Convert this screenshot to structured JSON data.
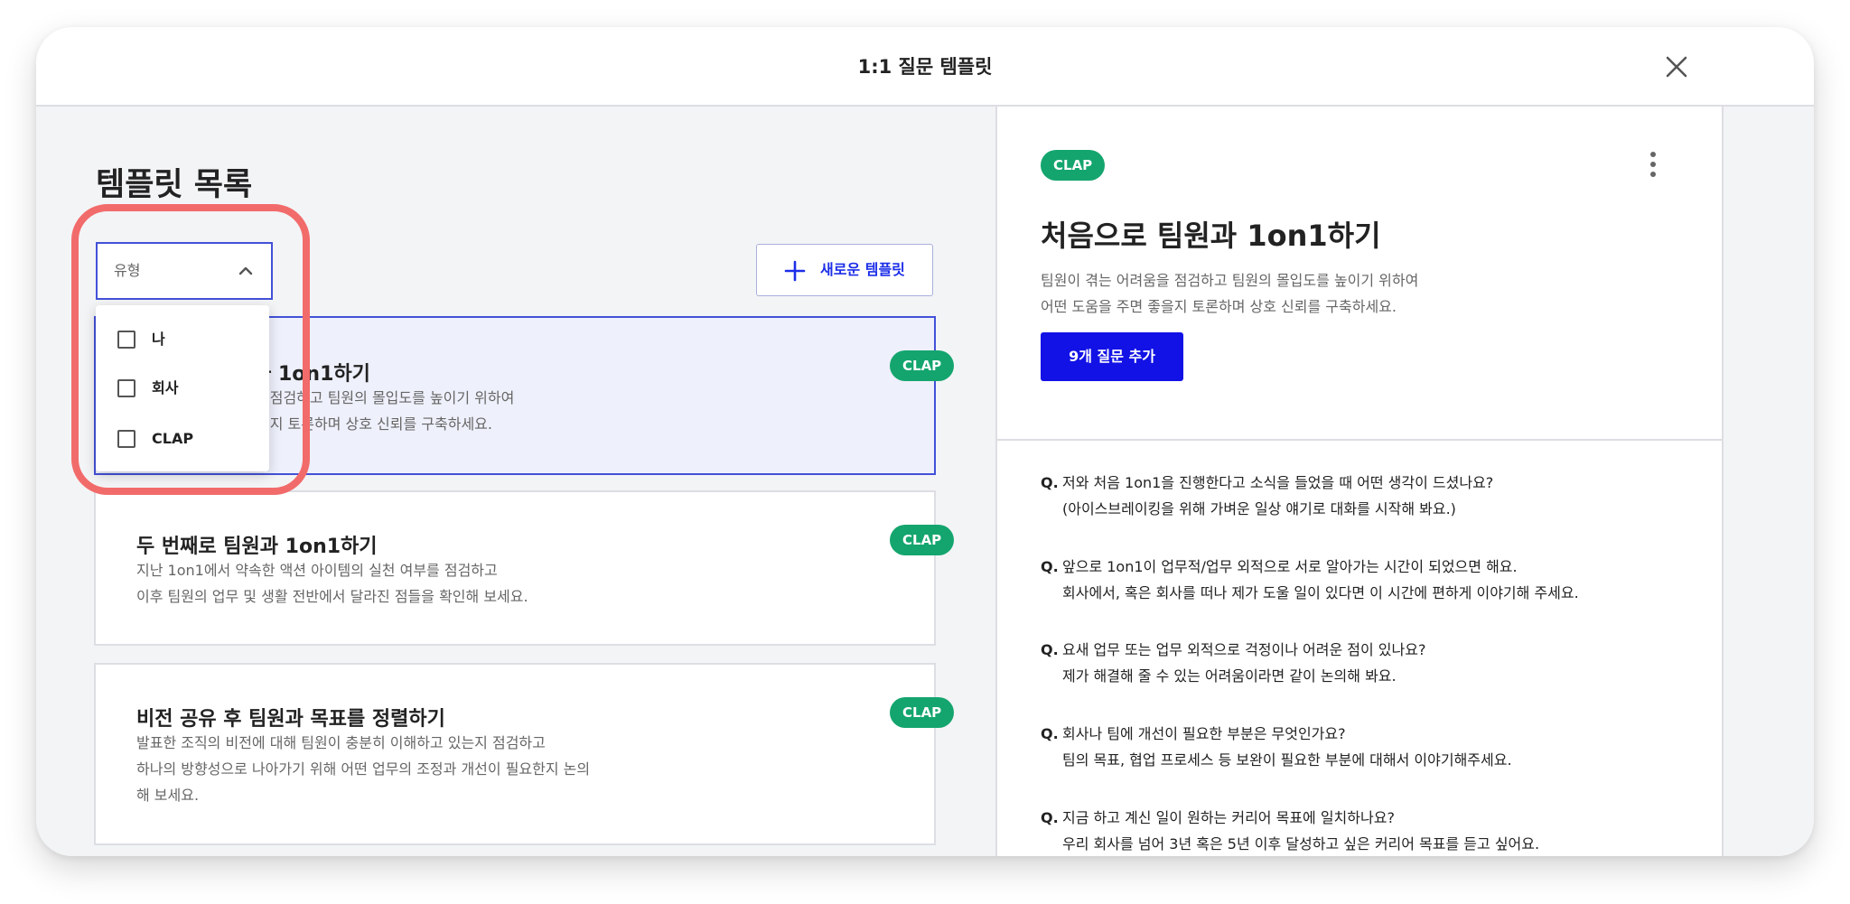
{
  "modal": {
    "title": "1:1 질문 템플릿"
  },
  "left": {
    "list_title": "템플릿 목록",
    "type_filter": {
      "label": "유형",
      "options": [
        "나",
        "회사",
        "CLAP"
      ]
    },
    "new_template_label": "새로운 템플릿",
    "templates": [
      {
        "title": "처음으로 팀원과 1on1하기",
        "desc_lines": [
          "팀원이 겪는 어려움을 점검하고 팀원의 몰입도를 높이기 위하여",
          "어떤 도움을 주면 좋을지 토론하며 상호 신뢰를 구축하세요."
        ],
        "badge": "CLAP"
      },
      {
        "title": "두 번째로 팀원과 1on1하기",
        "desc_lines": [
          "지난 1on1에서 약속한 액션 아이템의 실천 여부를 점검하고",
          "이후 팀원의 업무 및 생활 전반에서 달라진 점들을 확인해 보세요."
        ],
        "badge": "CLAP"
      },
      {
        "title": "비전 공유 후 팀원과 목표를 정렬하기",
        "desc_lines": [
          "발표한 조직의 비전에 대해 팀원이 충분히 이해하고 있는지 점검하고",
          "하나의 방향성으로 나아가기 위해 어떤 업무의 조정과 개선이 필요한지 논의",
          "해 보세요."
        ],
        "badge": "CLAP"
      }
    ]
  },
  "detail": {
    "badge": "CLAP",
    "title": "처음으로 팀원과 1on1하기",
    "desc_lines": [
      "팀원이 겪는 어려움을 점검하고 팀원의 몰입도를 높이기 위하여",
      "어떤 도움을 주면 좋을지 토론하며 상호 신뢰를 구축하세요."
    ],
    "add_button_label": "9개 질문 추가",
    "question_prefix": "Q.",
    "questions": [
      [
        "저와 처음 1on1을 진행한다고 소식을 들었을 때 어떤 생각이 드셨나요?",
        "(아이스브레이킹을 위해 가벼운 일상 얘기로 대화를 시작해 봐요.)"
      ],
      [
        "앞으로 1on1이 업무적/업무 외적으로 서로 알아가는 시간이 되었으면 해요.",
        "회사에서, 혹은 회사를 떠나 제가 도울 일이 있다면 이 시간에 편하게 이야기해 주세요."
      ],
      [
        "요새 업무 또는 업무 외적으로 걱정이나 어려운 점이 있나요?",
        "제가 해결해 줄 수 있는 어려움이라면 같이 논의해 봐요."
      ],
      [
        "회사나 팀에 개선이 필요한 부분은 무엇인가요?",
        "팀의 목표, 협업 프로세스 등 보완이 필요한 부분에 대해서 이야기해주세요."
      ],
      [
        "지금 하고 계신 일이 원하는 커리어 목표에 일치하나요?",
        "우리 회사를 넘어 3년 혹은 5년 이후 달성하고 싶은 커리어 목표를 듣고 싶어요."
      ]
    ]
  },
  "colors": {
    "accent": "#1212e6",
    "select_border": "#4351d8",
    "badge": "#14a56e",
    "highlight": "#f26b6b"
  }
}
